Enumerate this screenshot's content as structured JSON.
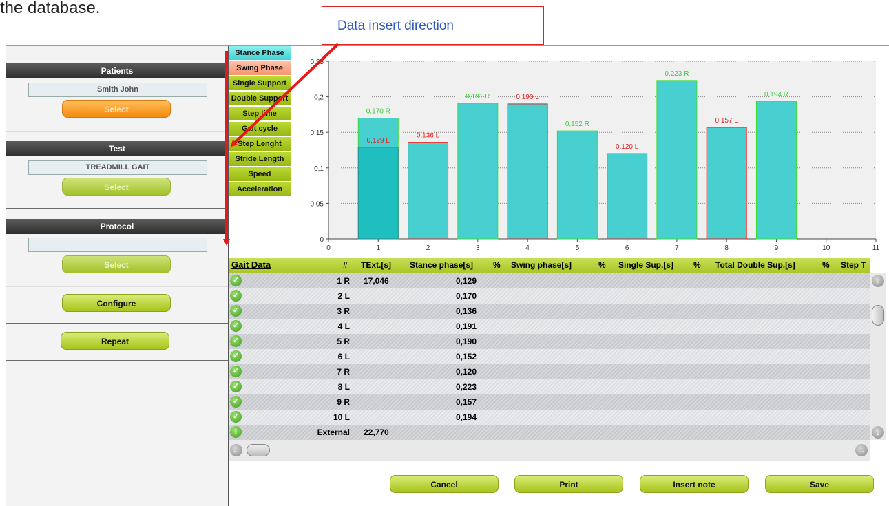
{
  "document_text": "the database.",
  "annotation": {
    "label": "Data insert direction"
  },
  "left_panel": {
    "patients": {
      "header": "Patients",
      "value": "Smith John",
      "select_label": "Select"
    },
    "test": {
      "header": "Test",
      "value": "TREADMILL GAIT",
      "select_label": "Select"
    },
    "protocol": {
      "header": "Protocol",
      "value": "",
      "select_label": "Select"
    },
    "configure_label": "Configure",
    "repeat_label": "Repeat"
  },
  "chart_tabs": [
    "Stance Phase",
    "Swing Phase",
    "Single Support",
    "Double Support",
    "Step time",
    "Gait cycle",
    "Step Lenght",
    "Stride Length",
    "Speed",
    "Acceleration"
  ],
  "colors": {
    "bar_fill": "#48cfcf",
    "bar_fill_dark": "#1fbfbf",
    "right_edge": "#3adb3a",
    "left_edge": "#e02020",
    "right_label": "#3ccc3c",
    "left_label": "#e02020",
    "table_header": "#b7d33b"
  },
  "chart_data": {
    "type": "bar",
    "xlim": [
      0,
      11
    ],
    "ylim": [
      0,
      0.25
    ],
    "x_ticks": [
      "0",
      "1",
      "2",
      "3",
      "4",
      "5",
      "6",
      "7",
      "8",
      "9",
      "10",
      "11"
    ],
    "y_ticks": [
      "0",
      "0,05",
      "0,1",
      "0,15",
      "0,2",
      "0,25"
    ],
    "grid": true,
    "x": [
      1,
      2,
      3,
      4,
      5,
      6,
      7,
      8,
      9
    ],
    "values": [
      0.17,
      0.136,
      0.191,
      0.19,
      0.152,
      0.12,
      0.223,
      0.157,
      0.194
    ],
    "sides": [
      "R",
      "L",
      "R",
      "L",
      "R",
      "L",
      "R",
      "L",
      "R"
    ],
    "labels": [
      "0,170 R",
      "0,136 L",
      "0,191 R",
      "0,190 L",
      "0,152 R",
      "0,120 L",
      "0,223 R",
      "0,157 L",
      "0,194 R"
    ],
    "overlay": {
      "x": 1,
      "value": 0.129,
      "side": "L",
      "label": "0,129 L"
    }
  },
  "table": {
    "title": "Gait Data",
    "columns": [
      "#",
      "TExt.[s]",
      "Stance phase[s]",
      "%",
      "Swing phase[s]",
      "%",
      "Single Sup.[s]",
      "%",
      "Total Double Sup.[s]",
      "%",
      "Step T"
    ],
    "rows": [
      {
        "num": "1 R",
        "text": "17,046",
        "stance": "0,129"
      },
      {
        "num": "2 L",
        "text": "",
        "stance": "0,170"
      },
      {
        "num": "3 R",
        "text": "",
        "stance": "0,136"
      },
      {
        "num": "4 L",
        "text": "",
        "stance": "0,191"
      },
      {
        "num": "5 R",
        "text": "",
        "stance": "0,190"
      },
      {
        "num": "6 L",
        "text": "",
        "stance": "0,152"
      },
      {
        "num": "7 R",
        "text": "",
        "stance": "0,120"
      },
      {
        "num": "8 L",
        "text": "",
        "stance": "0,223"
      },
      {
        "num": "9 R",
        "text": "",
        "stance": "0,157"
      },
      {
        "num": "10 L",
        "text": "",
        "stance": "0,194"
      },
      {
        "num": "External",
        "text": "22,770",
        "stance": ""
      }
    ]
  },
  "bottom_buttons": {
    "cancel": "Cancel",
    "print": "Print",
    "insert_note": "Insert note",
    "save": "Save"
  },
  "icons": {
    "row_ok": "check-icon",
    "row_warn": "exclamation-icon",
    "scroll_up": "arrow-up-icon",
    "scroll_down": "arrow-down-icon",
    "scroll_left": "arrow-left-icon",
    "scroll_right": "arrow-right-icon"
  }
}
